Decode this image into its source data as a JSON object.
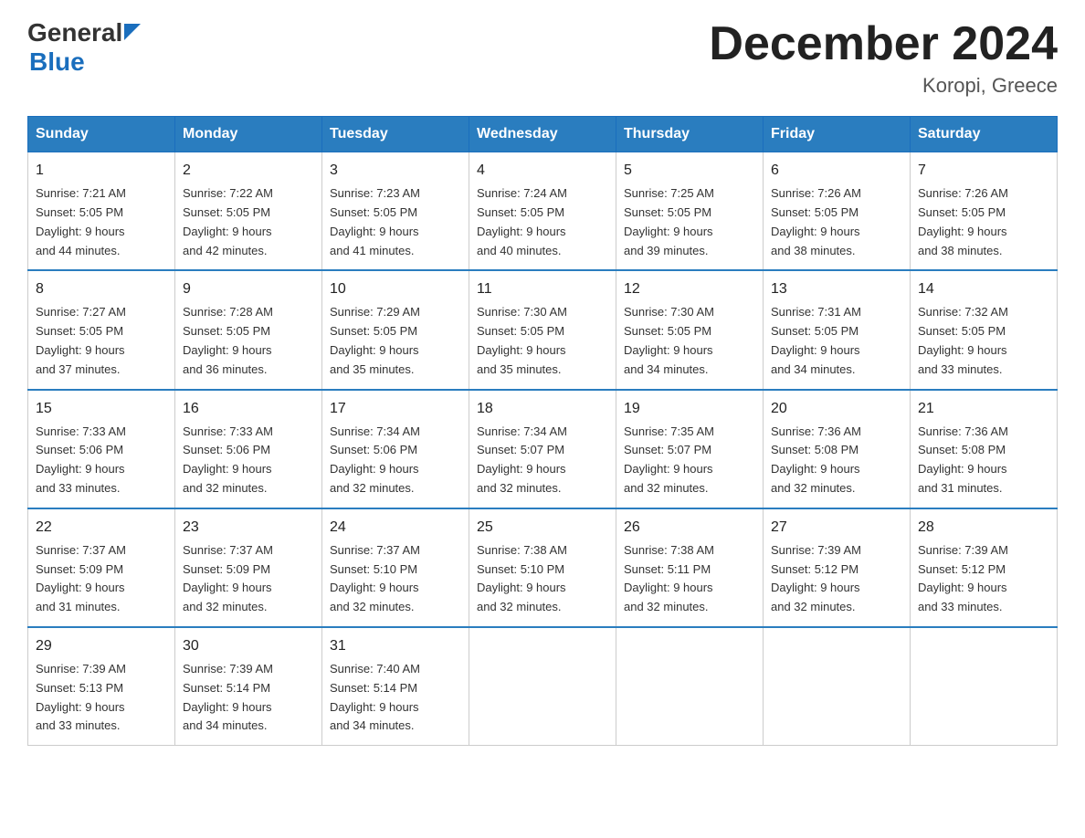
{
  "header": {
    "logo": {
      "general": "General",
      "blue": "Blue"
    },
    "title": "December 2024",
    "location": "Koropi, Greece"
  },
  "days_of_week": [
    "Sunday",
    "Monday",
    "Tuesday",
    "Wednesday",
    "Thursday",
    "Friday",
    "Saturday"
  ],
  "weeks": [
    [
      {
        "day": "1",
        "sunrise": "7:21 AM",
        "sunset": "5:05 PM",
        "daylight": "9 hours and 44 minutes."
      },
      {
        "day": "2",
        "sunrise": "7:22 AM",
        "sunset": "5:05 PM",
        "daylight": "9 hours and 42 minutes."
      },
      {
        "day": "3",
        "sunrise": "7:23 AM",
        "sunset": "5:05 PM",
        "daylight": "9 hours and 41 minutes."
      },
      {
        "day": "4",
        "sunrise": "7:24 AM",
        "sunset": "5:05 PM",
        "daylight": "9 hours and 40 minutes."
      },
      {
        "day": "5",
        "sunrise": "7:25 AM",
        "sunset": "5:05 PM",
        "daylight": "9 hours and 39 minutes."
      },
      {
        "day": "6",
        "sunrise": "7:26 AM",
        "sunset": "5:05 PM",
        "daylight": "9 hours and 38 minutes."
      },
      {
        "day": "7",
        "sunrise": "7:26 AM",
        "sunset": "5:05 PM",
        "daylight": "9 hours and 38 minutes."
      }
    ],
    [
      {
        "day": "8",
        "sunrise": "7:27 AM",
        "sunset": "5:05 PM",
        "daylight": "9 hours and 37 minutes."
      },
      {
        "day": "9",
        "sunrise": "7:28 AM",
        "sunset": "5:05 PM",
        "daylight": "9 hours and 36 minutes."
      },
      {
        "day": "10",
        "sunrise": "7:29 AM",
        "sunset": "5:05 PM",
        "daylight": "9 hours and 35 minutes."
      },
      {
        "day": "11",
        "sunrise": "7:30 AM",
        "sunset": "5:05 PM",
        "daylight": "9 hours and 35 minutes."
      },
      {
        "day": "12",
        "sunrise": "7:30 AM",
        "sunset": "5:05 PM",
        "daylight": "9 hours and 34 minutes."
      },
      {
        "day": "13",
        "sunrise": "7:31 AM",
        "sunset": "5:05 PM",
        "daylight": "9 hours and 34 minutes."
      },
      {
        "day": "14",
        "sunrise": "7:32 AM",
        "sunset": "5:05 PM",
        "daylight": "9 hours and 33 minutes."
      }
    ],
    [
      {
        "day": "15",
        "sunrise": "7:33 AM",
        "sunset": "5:06 PM",
        "daylight": "9 hours and 33 minutes."
      },
      {
        "day": "16",
        "sunrise": "7:33 AM",
        "sunset": "5:06 PM",
        "daylight": "9 hours and 32 minutes."
      },
      {
        "day": "17",
        "sunrise": "7:34 AM",
        "sunset": "5:06 PM",
        "daylight": "9 hours and 32 minutes."
      },
      {
        "day": "18",
        "sunrise": "7:34 AM",
        "sunset": "5:07 PM",
        "daylight": "9 hours and 32 minutes."
      },
      {
        "day": "19",
        "sunrise": "7:35 AM",
        "sunset": "5:07 PM",
        "daylight": "9 hours and 32 minutes."
      },
      {
        "day": "20",
        "sunrise": "7:36 AM",
        "sunset": "5:08 PM",
        "daylight": "9 hours and 32 minutes."
      },
      {
        "day": "21",
        "sunrise": "7:36 AM",
        "sunset": "5:08 PM",
        "daylight": "9 hours and 31 minutes."
      }
    ],
    [
      {
        "day": "22",
        "sunrise": "7:37 AM",
        "sunset": "5:09 PM",
        "daylight": "9 hours and 31 minutes."
      },
      {
        "day": "23",
        "sunrise": "7:37 AM",
        "sunset": "5:09 PM",
        "daylight": "9 hours and 32 minutes."
      },
      {
        "day": "24",
        "sunrise": "7:37 AM",
        "sunset": "5:10 PM",
        "daylight": "9 hours and 32 minutes."
      },
      {
        "day": "25",
        "sunrise": "7:38 AM",
        "sunset": "5:10 PM",
        "daylight": "9 hours and 32 minutes."
      },
      {
        "day": "26",
        "sunrise": "7:38 AM",
        "sunset": "5:11 PM",
        "daylight": "9 hours and 32 minutes."
      },
      {
        "day": "27",
        "sunrise": "7:39 AM",
        "sunset": "5:12 PM",
        "daylight": "9 hours and 32 minutes."
      },
      {
        "day": "28",
        "sunrise": "7:39 AM",
        "sunset": "5:12 PM",
        "daylight": "9 hours and 33 minutes."
      }
    ],
    [
      {
        "day": "29",
        "sunrise": "7:39 AM",
        "sunset": "5:13 PM",
        "daylight": "9 hours and 33 minutes."
      },
      {
        "day": "30",
        "sunrise": "7:39 AM",
        "sunset": "5:14 PM",
        "daylight": "9 hours and 34 minutes."
      },
      {
        "day": "31",
        "sunrise": "7:40 AM",
        "sunset": "5:14 PM",
        "daylight": "9 hours and 34 minutes."
      },
      null,
      null,
      null,
      null
    ]
  ],
  "labels": {
    "sunrise": "Sunrise:",
    "sunset": "Sunset:",
    "daylight": "Daylight:"
  }
}
